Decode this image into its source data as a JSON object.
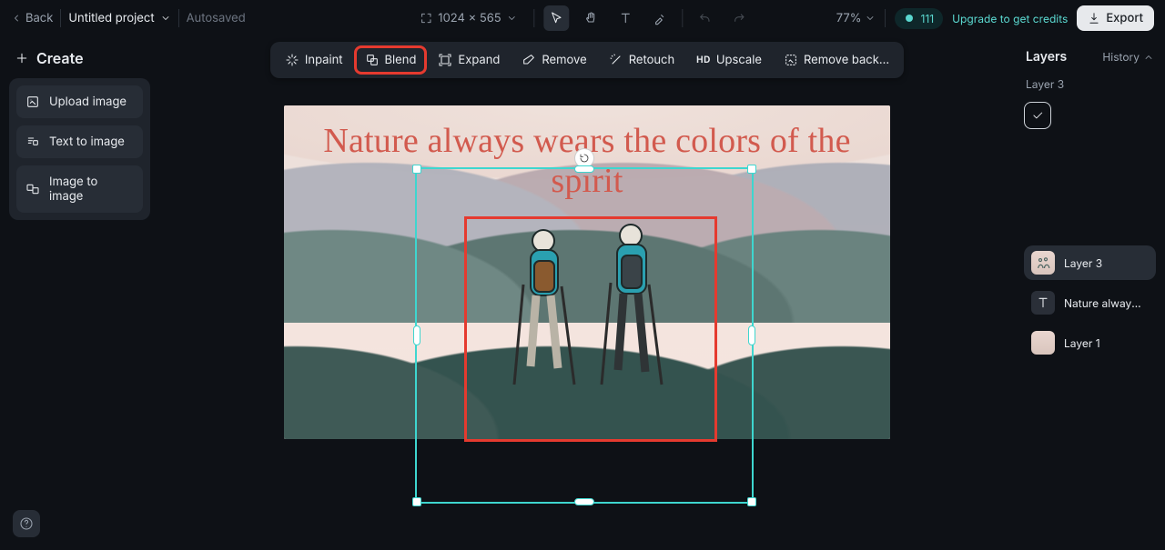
{
  "topbar": {
    "back_label": "Back",
    "project_name": "Untitled project",
    "autosaved_label": "Autosaved",
    "canvas_dim": "1024 × 565",
    "zoom_label": "77%",
    "credits_count": "111",
    "upgrade_label": "Upgrade to get credits",
    "export_label": "Export"
  },
  "toolbar": {
    "inpaint": "Inpaint",
    "blend": "Blend",
    "expand": "Expand",
    "remove": "Remove",
    "retouch": "Retouch",
    "upscale": "Upscale",
    "remove_bg": "Remove back…",
    "upscale_prefix": "HD"
  },
  "left": {
    "create": "Create",
    "upload": "Upload image",
    "text_to_image": "Text to image",
    "image_to_image": "Image to image"
  },
  "canvas": {
    "quote": "Nature always wears the colors of the spirit"
  },
  "right": {
    "layers_tab": "Layers",
    "history_tab": "History",
    "current_layer_title": "Layer 3",
    "layers": [
      {
        "name": "Layer 3"
      },
      {
        "name": "Nature always w…"
      },
      {
        "name": "Layer 1"
      }
    ]
  }
}
